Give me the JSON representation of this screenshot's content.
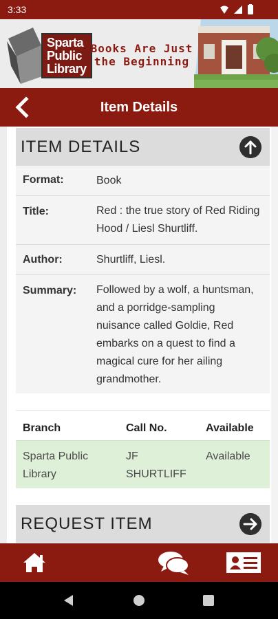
{
  "status_bar": {
    "time": "3:33"
  },
  "banner": {
    "logo_text": "Sparta Public Library",
    "tagline_line1": "Books Are Just",
    "tagline_line2": "the Beginning"
  },
  "header": {
    "title": "Item Details"
  },
  "item_details": {
    "section_title": "ITEM DETAILS",
    "fields": [
      {
        "label": "Format:",
        "value": "Book"
      },
      {
        "label": "Title:",
        "value": "Red : the true story of Red Riding Hood / Liesl Shurtliff."
      },
      {
        "label": "Author:",
        "value": "Shurtliff, Liesl."
      },
      {
        "label": "Summary:",
        "value": "Followed by a wolf, a huntsman, and a porridge-sampling nuisance called Goldie, Red embarks on a quest to find a magical cure for her ailing grandmother."
      }
    ]
  },
  "availability": {
    "columns": [
      "Branch",
      "Call No.",
      "Available"
    ],
    "rows": [
      {
        "branch": "Sparta Public Library",
        "call_no": "JF SHURTLIFF",
        "available": "Available"
      }
    ]
  },
  "request_item": {
    "section_title": "REQUEST ITEM"
  },
  "tab_bar": {
    "icons": [
      "home-icon",
      "chat-icon",
      "library-card-icon"
    ]
  },
  "colors": {
    "brand": "#8b1a11",
    "available_row": "#dff0d8",
    "section_header": "#dcdcdc"
  }
}
